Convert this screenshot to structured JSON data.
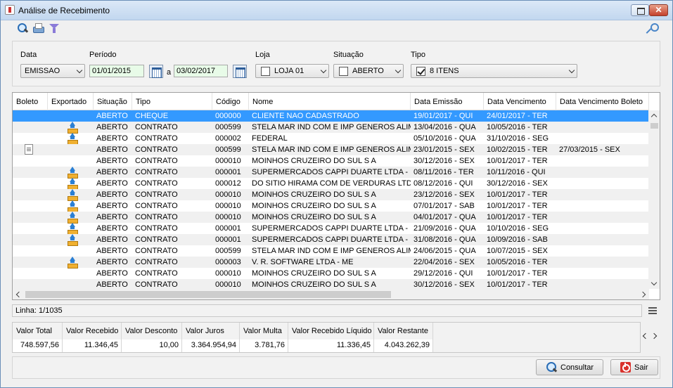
{
  "window": {
    "title": "Análise de Recebimento"
  },
  "filters": {
    "data_label": "Data",
    "data_value": "EMISSAO",
    "periodo_label": "Período",
    "date_from": "01/01/2015",
    "date_sep": "a",
    "date_to": "03/02/2017",
    "loja_label": "Loja",
    "loja_value": "LOJA 01",
    "situacao_label": "Situação",
    "situacao_value": "ABERTO",
    "tipo_label": "Tipo",
    "tipo_value": "8 ITENS"
  },
  "grid": {
    "columns": [
      "Boleto",
      "Exportado",
      "Situação",
      "Tipo",
      "Código",
      "Nome",
      "Data Emissão",
      "Data Vencimento",
      "Data Vencimento Boleto"
    ],
    "rows": [
      {
        "boleto": "",
        "exportado": false,
        "situacao": "ABERTO",
        "tipo": "CHEQUE",
        "codigo": "000000",
        "nome": "CLIENTE NAO CADASTRADO",
        "emissao": "19/01/2017 - QUI",
        "vencimento": "24/01/2017 - TER",
        "venc_boleto": ""
      },
      {
        "boleto": "",
        "exportado": true,
        "situacao": "ABERTO",
        "tipo": "CONTRATO",
        "codigo": "000599",
        "nome": "STELA MAR IND COM E IMP GENEROS ALIM L",
        "emissao": "13/04/2016 - QUA",
        "vencimento": "10/05/2016 - TER",
        "venc_boleto": ""
      },
      {
        "boleto": "",
        "exportado": true,
        "situacao": "ABERTO",
        "tipo": "CONTRATO",
        "codigo": "000002",
        "nome": "FEDERAL",
        "emissao": "05/10/2016 - QUA",
        "vencimento": "31/10/2016 - SEG",
        "venc_boleto": ""
      },
      {
        "boleto": "doc",
        "exportado": false,
        "situacao": "ABERTO",
        "tipo": "CONTRATO",
        "codigo": "000599",
        "nome": "STELA MAR IND COM E IMP GENEROS ALIM L",
        "emissao": "23/01/2015 - SEX",
        "vencimento": "10/02/2015 - TER",
        "venc_boleto": "27/03/2015 - SEX"
      },
      {
        "boleto": "",
        "exportado": false,
        "situacao": "ABERTO",
        "tipo": "CONTRATO",
        "codigo": "000010",
        "nome": "MOINHOS CRUZEIRO DO SUL S A",
        "emissao": "30/12/2016 - SEX",
        "vencimento": "10/01/2017 - TER",
        "venc_boleto": ""
      },
      {
        "boleto": "",
        "exportado": true,
        "situacao": "ABERTO",
        "tipo": "CONTRATO",
        "codigo": "000001",
        "nome": "SUPERMERCADOS CAPPI DUARTE LTDA - ME",
        "emissao": "08/11/2016 - TER",
        "vencimento": "10/11/2016 - QUI",
        "venc_boleto": ""
      },
      {
        "boleto": "",
        "exportado": true,
        "situacao": "ABERTO",
        "tipo": "CONTRATO",
        "codigo": "000012",
        "nome": "DO SITIO HIRAMA COM DE VERDURAS LTDA",
        "emissao": "08/12/2016 - QUI",
        "vencimento": "30/12/2016 - SEX",
        "venc_boleto": ""
      },
      {
        "boleto": "",
        "exportado": true,
        "situacao": "ABERTO",
        "tipo": "CONTRATO",
        "codigo": "000010",
        "nome": "MOINHOS CRUZEIRO DO SUL S A",
        "emissao": "23/12/2016 - SEX",
        "vencimento": "10/01/2017 - TER",
        "venc_boleto": ""
      },
      {
        "boleto": "",
        "exportado": true,
        "situacao": "ABERTO",
        "tipo": "CONTRATO",
        "codigo": "000010",
        "nome": "MOINHOS CRUZEIRO DO SUL S A",
        "emissao": "07/01/2017 - SAB",
        "vencimento": "10/01/2017 - TER",
        "venc_boleto": ""
      },
      {
        "boleto": "",
        "exportado": true,
        "situacao": "ABERTO",
        "tipo": "CONTRATO",
        "codigo": "000010",
        "nome": "MOINHOS CRUZEIRO DO SUL S A",
        "emissao": "04/01/2017 - QUA",
        "vencimento": "10/01/2017 - TER",
        "venc_boleto": ""
      },
      {
        "boleto": "",
        "exportado": true,
        "situacao": "ABERTO",
        "tipo": "CONTRATO",
        "codigo": "000001",
        "nome": "SUPERMERCADOS CAPPI DUARTE LTDA - ME",
        "emissao": "21/09/2016 - QUA",
        "vencimento": "10/10/2016 - SEG",
        "venc_boleto": ""
      },
      {
        "boleto": "",
        "exportado": true,
        "situacao": "ABERTO",
        "tipo": "CONTRATO",
        "codigo": "000001",
        "nome": "SUPERMERCADOS CAPPI DUARTE LTDA - ME",
        "emissao": "31/08/2016 - QUA",
        "vencimento": "10/09/2016 - SAB",
        "venc_boleto": ""
      },
      {
        "boleto": "",
        "exportado": false,
        "situacao": "ABERTO",
        "tipo": "CONTRATO",
        "codigo": "000599",
        "nome": "STELA MAR IND COM E IMP GENEROS ALIM L",
        "emissao": "24/06/2015 - QUA",
        "vencimento": "10/07/2015 - SEX",
        "venc_boleto": ""
      },
      {
        "boleto": "",
        "exportado": true,
        "situacao": "ABERTO",
        "tipo": "CONTRATO",
        "codigo": "000003",
        "nome": "V. R. SOFTWARE LTDA - ME",
        "emissao": "22/04/2016 - SEX",
        "vencimento": "10/05/2016 - TER",
        "venc_boleto": ""
      },
      {
        "boleto": "",
        "exportado": false,
        "situacao": "ABERTO",
        "tipo": "CONTRATO",
        "codigo": "000010",
        "nome": "MOINHOS CRUZEIRO DO SUL S A",
        "emissao": "29/12/2016 - QUI",
        "vencimento": "10/01/2017 - TER",
        "venc_boleto": ""
      },
      {
        "boleto": "",
        "exportado": false,
        "situacao": "ABERTO",
        "tipo": "CONTRATO",
        "codigo": "000010",
        "nome": "MOINHOS CRUZEIRO DO SUL S A",
        "emissao": "30/12/2016 - SEX",
        "vencimento": "10/01/2017 - TER",
        "venc_boleto": ""
      }
    ]
  },
  "status": {
    "linha": "Linha: 1/1035"
  },
  "totals": [
    {
      "label": "Valor Total",
      "value": "748.597,56"
    },
    {
      "label": "Valor Recebido",
      "value": "11.346,45"
    },
    {
      "label": "Valor Desconto",
      "value": "10,00"
    },
    {
      "label": "Valor Juros",
      "value": "3.364.954,94"
    },
    {
      "label": "Valor Multa",
      "value": "3.781,76"
    },
    {
      "label": "Valor Recebido Líquido",
      "value": "11.336,45"
    },
    {
      "label": "Valor Restante",
      "value": "4.043.262,39"
    }
  ],
  "buttons": {
    "consultar": "Consultar",
    "sair": "Sair"
  },
  "colors": {
    "selection": "#3399ff",
    "date_bg": "#e8fbe8",
    "exit_red": "#d9302b"
  }
}
